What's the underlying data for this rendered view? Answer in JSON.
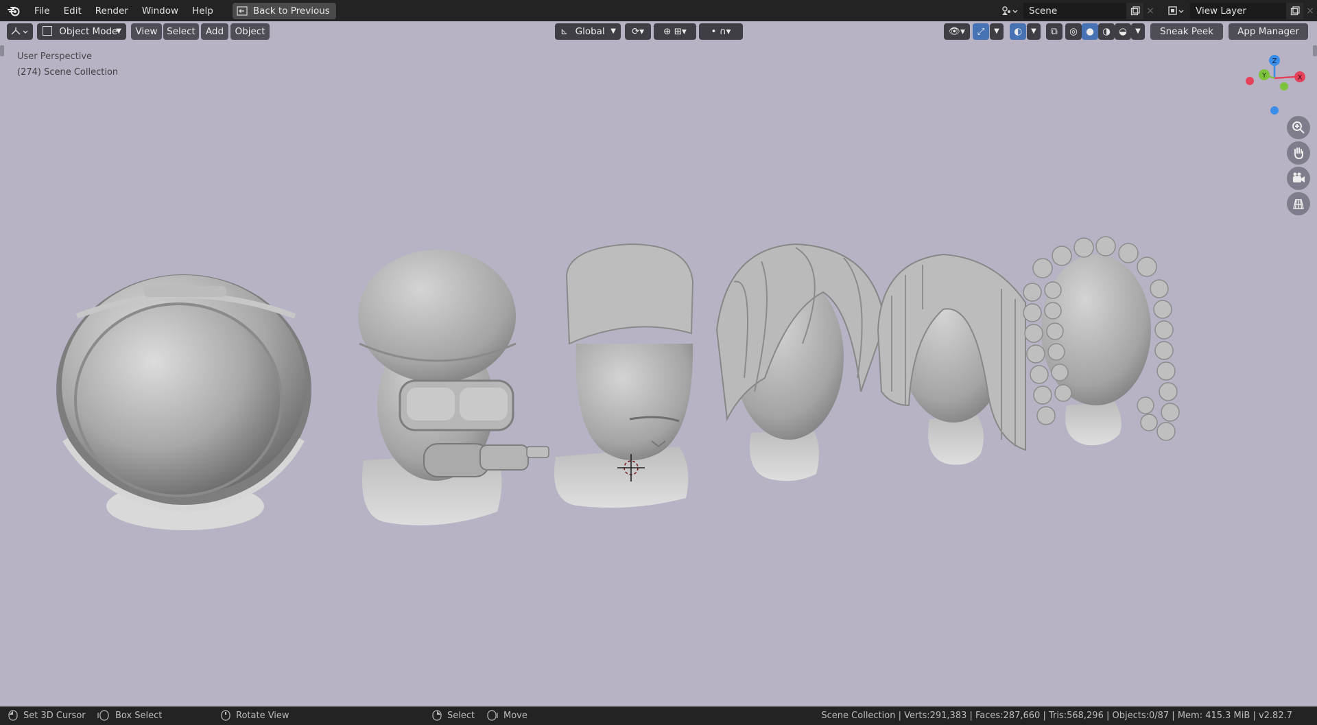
{
  "menu": {
    "items": [
      "File",
      "Edit",
      "Render",
      "Window",
      "Help"
    ],
    "back_button": "Back to Previous"
  },
  "top_right": {
    "scene_name": "Scene",
    "view_layer_name": "View Layer"
  },
  "viewport_header": {
    "mode": "Object Mode",
    "menus": [
      "View",
      "Select",
      "Add",
      "Object"
    ],
    "transform_orientation": "Global",
    "sneak_peek": "Sneak Peek",
    "app_manager": "App Manager"
  },
  "viewport": {
    "view_name": "User Perspective",
    "collection_label": "(274) Scene Collection",
    "gizmo_axes": [
      "Z",
      "Y",
      "X"
    ]
  },
  "statusbar": {
    "set_cursor": "Set 3D Cursor",
    "box_select": "Box Select",
    "rotate_view": "Rotate View",
    "select": "Select",
    "move": "Move",
    "stats": "Scene Collection | Verts:291,383 | Faces:287,660 | Tris:568,296 | Objects:0/87 | Mem: 415.3 MiB | v2.82.7"
  },
  "colors": {
    "viewport_bg": "#b7b2c4",
    "accent_blue": "#4772b3",
    "axis_x": "#e5425a",
    "axis_y": "#7dc23b",
    "axis_z": "#3b8ee8"
  }
}
